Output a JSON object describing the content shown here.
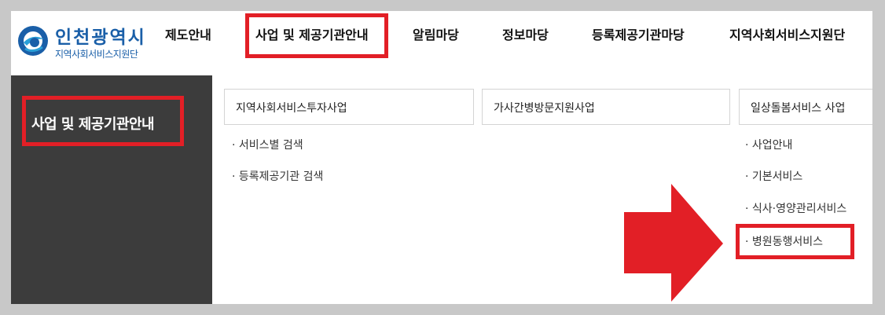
{
  "logo": {
    "title": "인천광역시",
    "subtitle": "지역사회서비스지원단"
  },
  "nav": {
    "items": [
      {
        "label": "제도안내"
      },
      {
        "label": "사업 및 제공기관안내"
      },
      {
        "label": "알림마당"
      },
      {
        "label": "정보마당"
      },
      {
        "label": "등록제공기관마당"
      },
      {
        "label": "지역사회서비스지원단"
      }
    ],
    "active_index": 1
  },
  "sidebar": {
    "title": "사업 및 제공기관안내"
  },
  "submenu": {
    "columns": [
      {
        "title": "지역사회서비스투자사업",
        "items": [
          "· 서비스별 검색",
          "· 등록제공기관 검색"
        ]
      },
      {
        "title": "가사간병방문지원사업",
        "items": []
      },
      {
        "title": "일상돌봄서비스 사업",
        "items": [
          "· 사업안내",
          "· 기본서비스",
          "· 식사·영양관리서비스",
          "· 병원동행서비스"
        ]
      }
    ]
  },
  "colors": {
    "highlight": "#e21f26",
    "sidebar_bg": "#3c3c3c",
    "logo_blue": "#1a5fa8"
  }
}
